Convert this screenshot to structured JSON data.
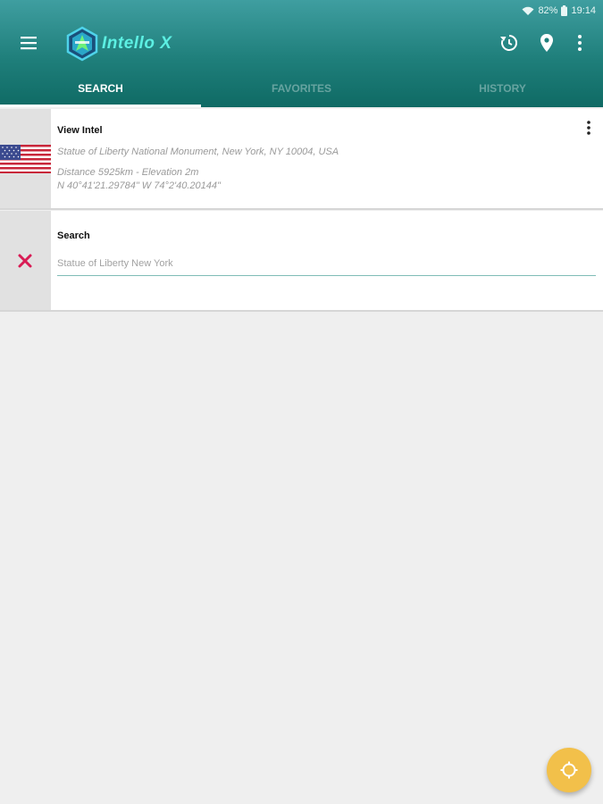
{
  "status_bar": {
    "battery": "82%",
    "time": "19:14"
  },
  "app": {
    "title": "Intello X"
  },
  "toolbar": {
    "menu_icon": "hamburger-menu-icon",
    "history_icon": "history-icon",
    "location_icon": "location-pin-icon",
    "overflow_icon": "more-vertical-icon"
  },
  "tabs": [
    {
      "label": "SEARCH",
      "active": true
    },
    {
      "label": "FAVORITES",
      "active": false
    },
    {
      "label": "HISTORY",
      "active": false
    }
  ],
  "intel_card": {
    "title": "View Intel",
    "address": "Statue of Liberty National Monument, New York, NY 10004, USA",
    "distance": "Distance 5925km - Elevation 2m",
    "coordinates": "N 40°41'21.29784\" W 74°2'40.20144\"",
    "flag_icon": "us-flag-icon"
  },
  "search_card": {
    "title": "Search",
    "placeholder": "Statue of Liberty New York",
    "value": "",
    "clear_icon": "close-icon"
  },
  "fab": {
    "icon": "my-location-icon"
  },
  "colors": {
    "appbar": "#1f7f7b",
    "title_accent": "#5cf0e3",
    "fab": "#f2c04a",
    "clear_x": "#d81b54"
  }
}
